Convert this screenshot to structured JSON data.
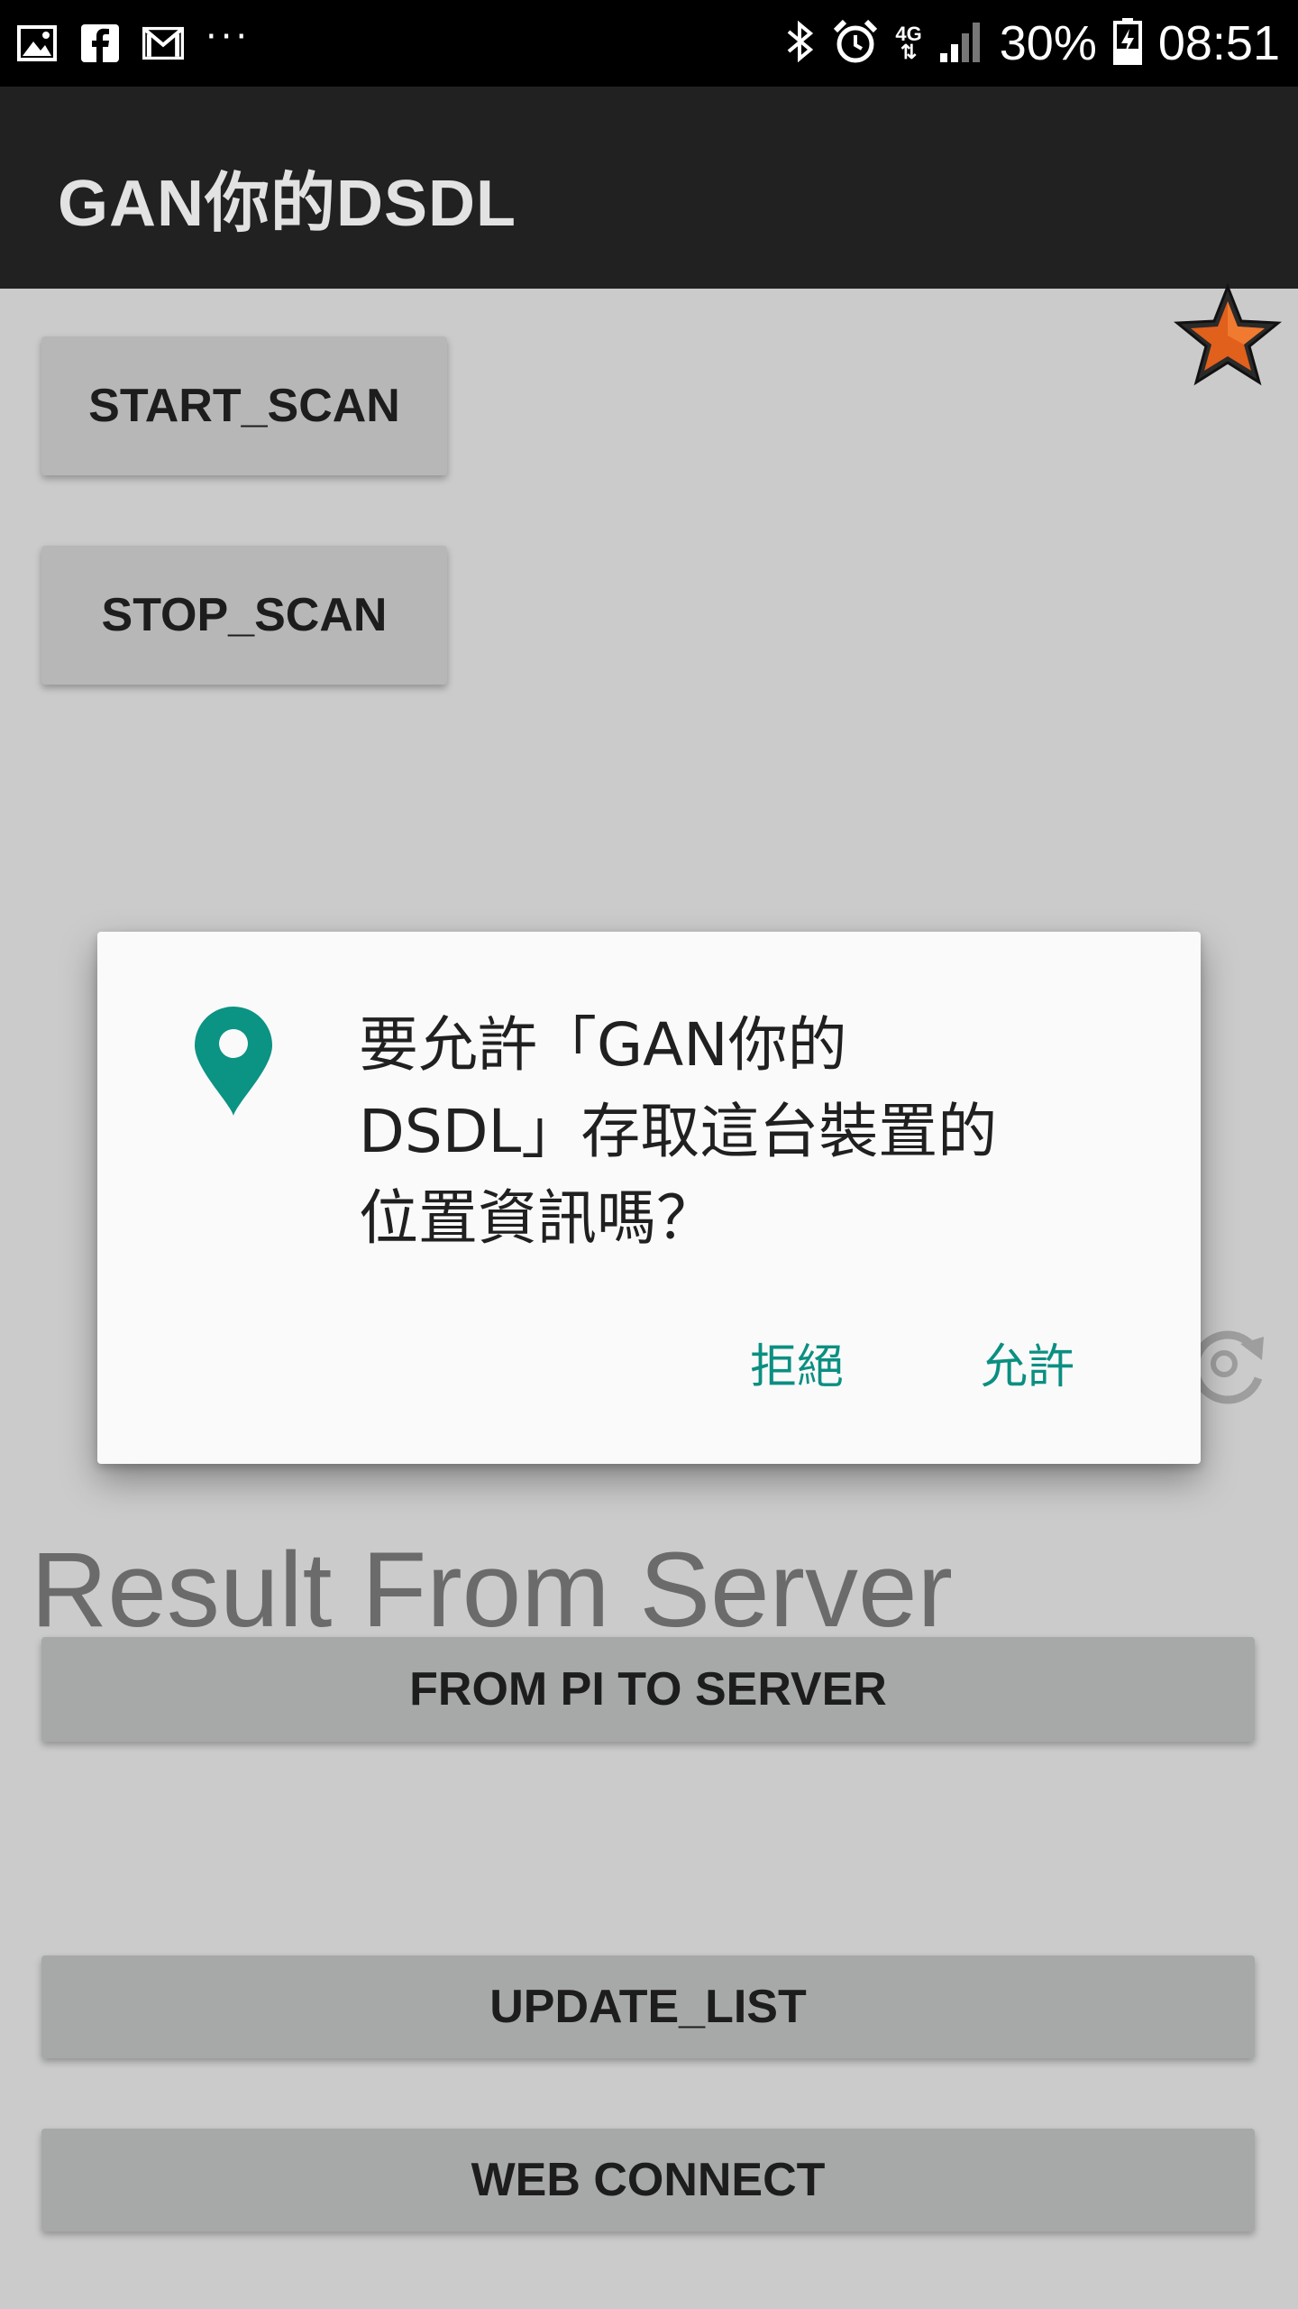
{
  "status_bar": {
    "left_icons": [
      "image-icon",
      "facebook-icon",
      "gmail-icon"
    ],
    "more": "···",
    "right_icons": [
      "bluetooth-icon",
      "alarm-icon",
      "signal-icon",
      "battery-icon"
    ],
    "network_type": "4G",
    "battery": "30%",
    "time": "08:51"
  },
  "app_bar": {
    "title": "GAN你的DSDL"
  },
  "buttons": {
    "start_scan": "START_SCAN",
    "stop_scan": "STOP_SCAN",
    "from_pi": "FROM PI TO SERVER",
    "update_list": "UPDATE_LIST",
    "web_connect": "WEB CONNECT"
  },
  "result_label": "Result From Server",
  "icons": {
    "favorite": "star-icon",
    "refresh": "refresh-icon",
    "location": "location-pin-icon"
  },
  "dialog": {
    "message_line1": "要允許「GAN你的",
    "message_line2": "DSDL」存取這台裝置的",
    "message_line3": "位置資訊嗎？",
    "deny": "拒絕",
    "allow": "允許"
  },
  "colors": {
    "accent": "#0b9384",
    "app_bar": "#212121",
    "background": "#cbcbcb"
  }
}
